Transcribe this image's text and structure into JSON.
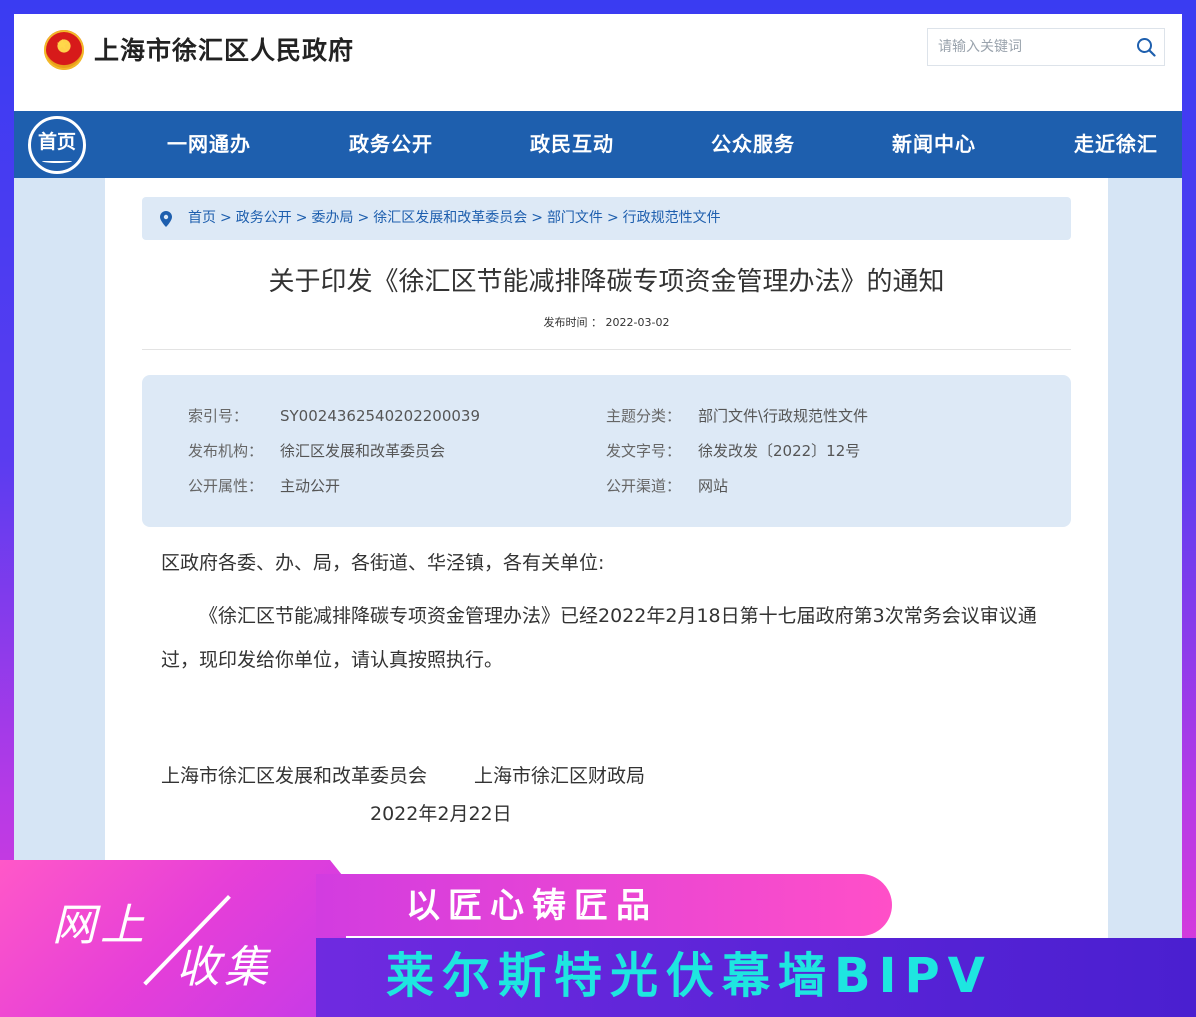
{
  "header": {
    "site_title": "上海市徐汇区人民政府",
    "search_placeholder": "请输入关键词"
  },
  "nav": {
    "home": "首页",
    "items": [
      "一网通办",
      "政务公开",
      "政民互动",
      "公众服务",
      "新闻中心",
      "走近徐汇"
    ]
  },
  "breadcrumb": [
    "首页",
    "政务公开",
    "委办局",
    "徐汇区发展和改革委员会",
    "部门文件",
    "行政规范性文件"
  ],
  "article": {
    "title": "关于印发《徐汇区节能减排降碳专项资金管理办法》的通知",
    "publish_label": "发布时间",
    "publish_date": "2022-03-02"
  },
  "meta": {
    "index_label": "索引号：",
    "index_value": "SY0024362540202200039",
    "topic_label": "主题分类：",
    "topic_value": "部门文件\\行政规范性文件",
    "issuer_label": "发布机构：",
    "issuer_value": "徐汇区发展和改革委员会",
    "doc_no_label": "发文字号：",
    "doc_no_value": "徐发改发〔2022〕12号",
    "public_attr_label": "公开属性：",
    "public_attr_value": "主动公开",
    "channel_label": "公开渠道：",
    "channel_value": "网站"
  },
  "body": {
    "salutation": "区政府各委、办、局，各街道、华泾镇，各有关单位:",
    "paragraph": "《徐汇区节能减排降碳专项资金管理办法》已经2022年2月18日第十七届政府第3次常务会议审议通过，现印发给你单位，请认真按照执行。",
    "signature_1": "上海市徐汇区发展和改革委员会",
    "signature_2": "上海市徐汇区财政局",
    "date": "2022年2月22日"
  },
  "banner": {
    "word_1": "网上",
    "word_2": "收集",
    "motto": "以匠心铸匠品",
    "brand": "莱尔斯特光伏幕墙BIPV"
  },
  "colors": {
    "nav_bg": "#1e5fae",
    "panel_bg": "#ffffff",
    "meta_bg": "#dde9f6",
    "brand_cyan": "#1ee6e0"
  }
}
